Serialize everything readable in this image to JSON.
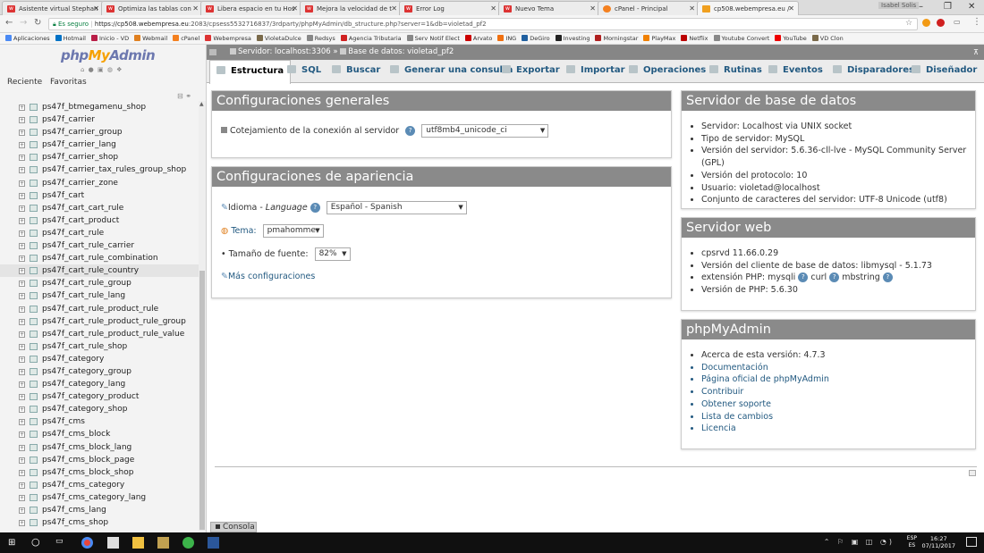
{
  "browser": {
    "tabs": [
      {
        "label": "Asistente virtual Stephan",
        "icon": "webempresa-icon"
      },
      {
        "label": "Optimiza las tablas con",
        "icon": "webempresa-icon"
      },
      {
        "label": "Libera espacio en tu Hos",
        "icon": "webempresa-icon"
      },
      {
        "label": "Mejora la velocidad de t",
        "icon": "webempresa-icon"
      },
      {
        "label": "Error Log",
        "icon": "webempresa-icon"
      },
      {
        "label": "Nuevo Tema",
        "icon": "webempresa-icon"
      },
      {
        "label": "cPanel - Principal",
        "icon": "cpanel-icon"
      },
      {
        "label": "cp508.webempresa.eu /",
        "icon": "phpmyadmin-icon"
      }
    ],
    "user_label": "Isabel Solis",
    "window_controls": [
      "–",
      "❐",
      "✕"
    ],
    "secure_label": "Es seguro",
    "url_host": "https://cp508.webempresa.eu",
    "url_rest": ":2083/cpsess5532716837/3rdparty/phpMyAdmin/db_structure.php?server=1&db=violetad_pf2",
    "bookmarks": [
      "Aplicaciones",
      "Hotmail",
      "Inicio - VD",
      "Webmail",
      "cPanel",
      "Webempresa",
      "VioletaDulce",
      "Redsys",
      "Agencia Tributaria",
      "Serv Notif Elect",
      "Arvato",
      "ING",
      "DeGiro",
      "Investing",
      "Morningstar",
      "PlayMax",
      "Netflix",
      "Youtube Convert",
      "YouTube",
      "VD Clon"
    ]
  },
  "left": {
    "logo_php": "php",
    "logo_my": "My",
    "logo_admin": "Admin",
    "logo_icons": "⌂ ● ▣ ◍ ❖",
    "recent": "Reciente",
    "favorites": "Favoritas",
    "collapse_icons": "⊟ ⚭",
    "tables": [
      "ps47f_btmegamenu_shop",
      "ps47f_carrier",
      "ps47f_carrier_group",
      "ps47f_carrier_lang",
      "ps47f_carrier_shop",
      "ps47f_carrier_tax_rules_group_shop",
      "ps47f_carrier_zone",
      "ps47f_cart",
      "ps47f_cart_cart_rule",
      "ps47f_cart_product",
      "ps47f_cart_rule",
      "ps47f_cart_rule_carrier",
      "ps47f_cart_rule_combination",
      "ps47f_cart_rule_country",
      "ps47f_cart_rule_group",
      "ps47f_cart_rule_lang",
      "ps47f_cart_rule_product_rule",
      "ps47f_cart_rule_product_rule_group",
      "ps47f_cart_rule_product_rule_value",
      "ps47f_cart_rule_shop",
      "ps47f_category",
      "ps47f_category_group",
      "ps47f_category_lang",
      "ps47f_category_product",
      "ps47f_category_shop",
      "ps47f_cms",
      "ps47f_cms_block",
      "ps47f_cms_block_lang",
      "ps47f_cms_block_page",
      "ps47f_cms_block_shop",
      "ps47f_cms_category",
      "ps47f_cms_category_lang",
      "ps47f_cms_lang",
      "ps47f_cms_shop"
    ],
    "highlighted_table": "ps47f_cart_rule_country"
  },
  "breadcrumb": {
    "server": "Servidor: localhost:3306",
    "sep": "»",
    "database": "Base de datos: violetad_pf2"
  },
  "nav_tabs": [
    "Estructura",
    "SQL",
    "Buscar",
    "Generar una consulta",
    "Exportar",
    "Importar",
    "Operaciones",
    "Rutinas",
    "Eventos",
    "Disparadores",
    "Diseñador"
  ],
  "general": {
    "title": "Configuraciones generales",
    "collation_label": "Cotejamiento de la conexión al servidor",
    "collation_value": "utf8mb4_unicode_ci"
  },
  "appearance": {
    "title": "Configuraciones de apariencia",
    "language_label": "Idioma - ",
    "language_label_en": "Language",
    "language_value": "Español - Spanish",
    "theme_label": "Tema:",
    "theme_value": "pmahomme",
    "fontsize_label": "Tamaño de fuente:",
    "fontsize_value": "82%",
    "more_settings": "Más configuraciones"
  },
  "db_server": {
    "title": "Servidor de base de datos",
    "items": [
      "Servidor: Localhost via UNIX socket",
      "Tipo de servidor: MySQL",
      "Versión del servidor: 5.6.36-cll-lve - MySQL Community Server (GPL)",
      "Versión del protocolo: 10",
      "Usuario: violetad@localhost",
      "Conjunto de caracteres del servidor: UTF-8 Unicode (utf8)"
    ]
  },
  "web_server": {
    "title": "Servidor web",
    "items": [
      "cpsrvd 11.66.0.29",
      "Versión del cliente de base de datos: libmysql - 5.1.73"
    ],
    "php_ext_label": "extensión PHP: ",
    "php_exts": [
      "mysqli",
      "curl",
      "mbstring"
    ],
    "php_version": "Versión de PHP: 5.6.30"
  },
  "pma": {
    "title": "phpMyAdmin",
    "version": "Acerca de esta versión: 4.7.3",
    "links": [
      "Documentación",
      "Página oficial de phpMyAdmin",
      "Contribuir",
      "Obtener soporte",
      "Lista de cambios",
      "Licencia"
    ]
  },
  "console_label": "Consola",
  "taskbar": {
    "lang_top": "ESP",
    "lang_bottom": "ES",
    "time": "16:27",
    "date": "07/11/2017"
  },
  "colors": {
    "link": "#235a81",
    "panel_header": "#8a8a8a",
    "logo_blue": "#6c78af",
    "logo_orange": "#f6a000"
  }
}
